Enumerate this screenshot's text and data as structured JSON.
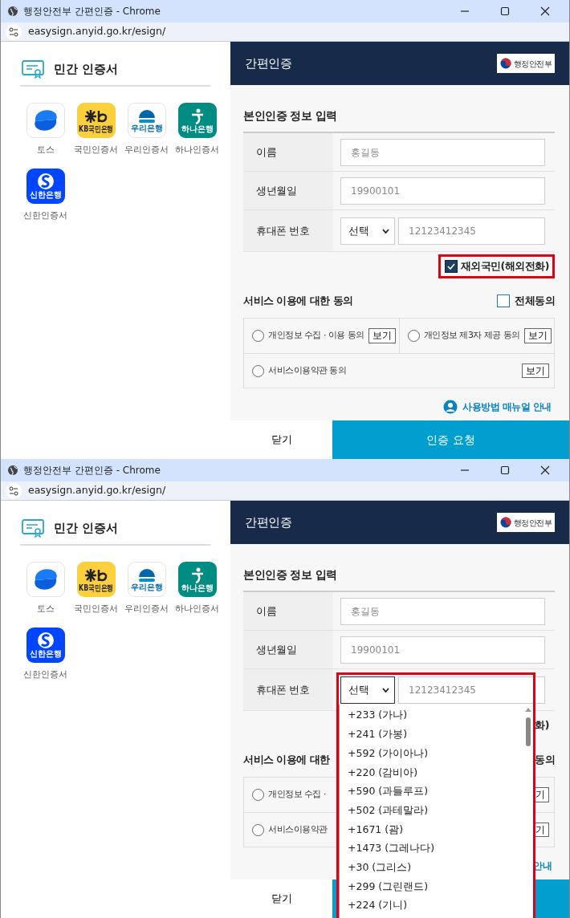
{
  "windows": [
    {
      "title": "행정안전부 간편인증 - Chrome",
      "url": "easysign.anyid.go.kr/esign/",
      "sidebar": {
        "title": "민간 인증서",
        "providers": [
          {
            "kind": "toss",
            "label": "토스"
          },
          {
            "kind": "kb",
            "logo_text": "KB국민은행",
            "label": "국민인증서"
          },
          {
            "kind": "woori",
            "logo_text": "우리은행",
            "label": "우리인증서"
          },
          {
            "kind": "hana",
            "logo_text": "하나은행",
            "label": "하나인증서"
          },
          {
            "kind": "shinhan",
            "logo_text": "신한은행",
            "label": "신한인증서"
          }
        ]
      },
      "header": {
        "title": "간편인증",
        "logo_text": "행정안전부"
      },
      "form": {
        "title": "본인인증 정보 입력",
        "fields": [
          {
            "kind": "text",
            "label": "이름",
            "placeholder": "홍길동"
          },
          {
            "kind": "text",
            "label": "생년월일",
            "placeholder": "19900101"
          },
          {
            "kind": "phone",
            "label": "휴대폰 번호",
            "select": "선택",
            "placeholder": "12123412345",
            "open": false
          }
        ]
      },
      "overseas": {
        "label": "재외국민(해외전화)",
        "checked": true,
        "highlighted": true
      },
      "consent": {
        "title": "서비스 이용에 대한 동의",
        "all": {
          "label": "전체동의",
          "checked": false
        },
        "items": [
          {
            "label": "개인정보 수집 · 이용 동의",
            "selected": false,
            "button": "보기"
          },
          {
            "label": "개인정보 제3자 제공 동의",
            "selected": false,
            "button": "보기"
          },
          {
            "label": "서비스이용약관 동의",
            "selected": false,
            "button": "보기"
          }
        ]
      },
      "manual_link": {
        "label": "사용방법 매뉴얼 안내",
        "icon": true
      },
      "buttons": {
        "close": "닫기",
        "submit": "인증 요청"
      }
    },
    {
      "title": "행정안전부 간편인증 - Chrome",
      "url": "easysign.anyid.go.kr/esign/",
      "sidebar": {
        "title": "민간 인증서",
        "providers": [
          {
            "kind": "toss",
            "label": "토스"
          },
          {
            "kind": "kb",
            "logo_text": "KB국민은행",
            "label": "국민인증서"
          },
          {
            "kind": "woori",
            "logo_text": "우리은행",
            "label": "우리인증서"
          },
          {
            "kind": "hana",
            "logo_text": "하나은행",
            "label": "하나인증서"
          },
          {
            "kind": "shinhan",
            "logo_text": "신한은행",
            "label": "신한인증서"
          }
        ]
      },
      "header": {
        "title": "간편인증",
        "logo_text": "행정안전부"
      },
      "form": {
        "title": "본인인증 정보 입력",
        "fields": [
          {
            "kind": "text",
            "label": "이름",
            "placeholder": "홍길동"
          },
          {
            "kind": "text",
            "label": "생년월일",
            "placeholder": "19900101"
          },
          {
            "kind": "phone",
            "label": "휴대폰 번호",
            "select": "선택",
            "placeholder": "12123412345",
            "open": true
          }
        ]
      },
      "overseas": {
        "label": "화)",
        "highlighted": false
      },
      "consent": {
        "title": "서비스 이용에 대한",
        "all": {
          "label": "동의"
        },
        "items": [
          {
            "label": "개인정보 수집 ·",
            "selected": false
          },
          {
            "button": "기"
          },
          {
            "label": "서비스이용약관",
            "selected": false,
            "button": "기"
          }
        ]
      },
      "manual_link": {
        "label": "안내"
      },
      "buttons": {
        "close": "닫기"
      },
      "dropdown": {
        "highlighted": true,
        "options": [
          {
            "label": "+233 (가나)",
            "selected": false
          },
          {
            "label": "+241 (가봉)",
            "selected": false
          },
          {
            "label": "+592 (가이아나)",
            "selected": false
          },
          {
            "label": "+220 (감비아)",
            "selected": false
          },
          {
            "label": "+590 (과들루프)",
            "selected": false
          },
          {
            "label": "+502 (과테말라)",
            "selected": false
          },
          {
            "label": "+1671 (괌)",
            "selected": false
          },
          {
            "label": "+1473 (그레나다)",
            "selected": false
          },
          {
            "label": "+30 (그리스)",
            "selected": false
          },
          {
            "label": "+299 (그린랜드)",
            "selected": false
          },
          {
            "label": "+224 (기니)",
            "selected": false
          }
        ]
      }
    }
  ]
}
